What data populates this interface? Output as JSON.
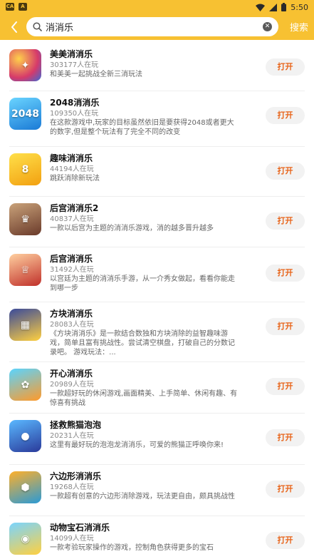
{
  "status": {
    "time": "5:50"
  },
  "search": {
    "value": "消消乐",
    "button": "搜索"
  },
  "button_label": "打开",
  "items": [
    {
      "name": "美美消消乐",
      "players": "303177人在玩",
      "desc": "和美美一起挑战全新三消玩法"
    },
    {
      "name": "2048消消乐",
      "players": "109350人在玩",
      "desc": "在这款游戏中,玩家的目标虽然依旧是要获得2048或者更大的数字,但是整个玩法有了完全不同的改变"
    },
    {
      "name": "趣味消消乐",
      "players": "44194人在玩",
      "desc": "跳跃消除新玩法"
    },
    {
      "name": "后宫消消乐2",
      "players": "40837人在玩",
      "desc": "一款以后宫为主题的消消乐游戏，消的越多晋升越多"
    },
    {
      "name": "后宫消消乐",
      "players": "31492人在玩",
      "desc": "以宫廷为主题的消消乐手游，从一介秀女做起，看看你能走到哪一步"
    },
    {
      "name": "方块消消乐",
      "players": "28083人在玩",
      "desc": "《方块消消乐》是一款结合数独和方块消除的益智趣味游戏，简单且富有挑战性。尝试清空棋盘，打破自己的分数记录吧。 游戏玩法：..."
    },
    {
      "name": "开心消消乐",
      "players": "20989人在玩",
      "desc": "一款超好玩的休闲游戏,画面精美、上手简单、休闲有趣、有惊喜有挑战"
    },
    {
      "name": "拯救熊猫泡泡",
      "players": "20231人在玩",
      "desc": "这里有最好玩的泡泡龙消消乐，可爱的熊猫正呼唤你来!"
    },
    {
      "name": "六边形消消乐",
      "players": "19268人在玩",
      "desc": "一款超有创意的六边形消除游戏，玩法更自由，颇具挑战性"
    },
    {
      "name": "动物宝石消消乐",
      "players": "14099人在玩",
      "desc": "一款考验玩家操作的游戏，控制角色获得更多的宝石"
    }
  ]
}
